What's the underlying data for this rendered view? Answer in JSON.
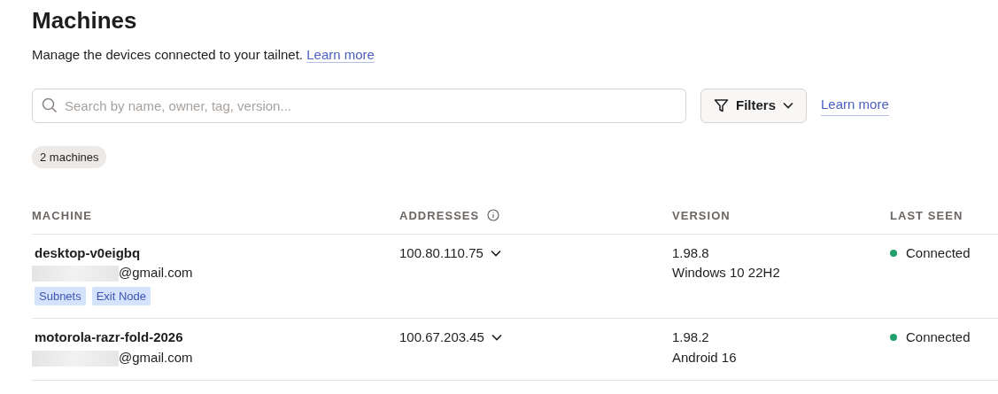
{
  "page": {
    "title": "Machines",
    "subtitle": "Manage the devices connected to your tailnet.",
    "subtitle_link": "Learn more"
  },
  "search": {
    "placeholder": "Search by name, owner, tag, version..."
  },
  "filters_button": "Filters",
  "learn_more_link": "Learn more",
  "count_badge": "2 machines",
  "table": {
    "columns": [
      {
        "label": "MACHINE",
        "info": false
      },
      {
        "label": "ADDRESSES",
        "info": true
      },
      {
        "label": "VERSION",
        "info": false
      },
      {
        "label": "LAST SEEN",
        "info": false
      }
    ],
    "rows": [
      {
        "name": "desktop-v0eigbq",
        "email": "@gmail.com",
        "email_redacted": true,
        "tags": [
          "Subnets",
          "Exit Node"
        ],
        "address": "100.80.110.75",
        "version": "1.98.8",
        "os": "Windows 10 22H2",
        "status": "Connected",
        "color": "#22a06b"
      },
      {
        "name": "motorola-razr-fold-2026",
        "email": "@gmail.com",
        "email_redacted": true,
        "tags": [],
        "address": "100.67.203.45",
        "version": "1.98.2",
        "os": "Android 16",
        "status": "Connected",
        "color": "#22a06b"
      }
    ]
  }
}
